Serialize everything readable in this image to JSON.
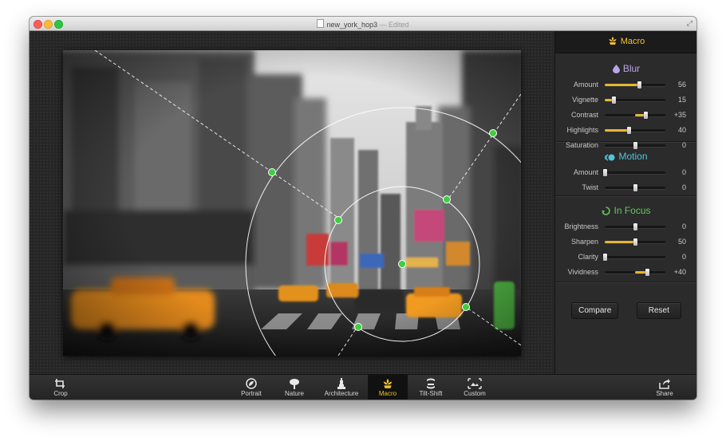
{
  "window": {
    "filename": "new_york_hop3",
    "status": "— Edited"
  },
  "sidebar": {
    "preset": "Macro",
    "sections": [
      {
        "title": "Blur",
        "color": "#b9a6e8",
        "sliders": [
          {
            "label": "Amount",
            "value": "56",
            "level": 0.56
          },
          {
            "label": "Vignette",
            "value": "15",
            "level": 0.15
          },
          {
            "label": "Contrast",
            "value": "+35",
            "level": 0.675
          },
          {
            "label": "Highlights",
            "value": "40",
            "level": 0.4
          },
          {
            "label": "Saturation",
            "value": "0",
            "level": 0.5
          }
        ]
      },
      {
        "title": "Motion",
        "color": "#4fc6de",
        "sliders": [
          {
            "label": "Amount",
            "value": "0",
            "level": 0
          },
          {
            "label": "Twist",
            "value": "0",
            "level": 0.5
          }
        ]
      },
      {
        "title": "In Focus",
        "color": "#66c85c",
        "sliders": [
          {
            "label": "Brightness",
            "value": "0",
            "level": 0.5
          },
          {
            "label": "Sharpen",
            "value": "50",
            "level": 0.5
          },
          {
            "label": "Clarity",
            "value": "0",
            "level": 0
          },
          {
            "label": "Vividness",
            "value": "+40",
            "level": 0.7
          }
        ]
      }
    ],
    "compare_label": "Compare",
    "reset_label": "Reset"
  },
  "toolbar": {
    "crop": "Crop",
    "presets": [
      "Portrait",
      "Nature",
      "Architecture",
      "Macro",
      "Tilt-Shift",
      "Custom"
    ],
    "active": "Macro",
    "share": "Share"
  },
  "colors": {
    "accent": "#f1c12f",
    "handle": "#3fce3f"
  }
}
